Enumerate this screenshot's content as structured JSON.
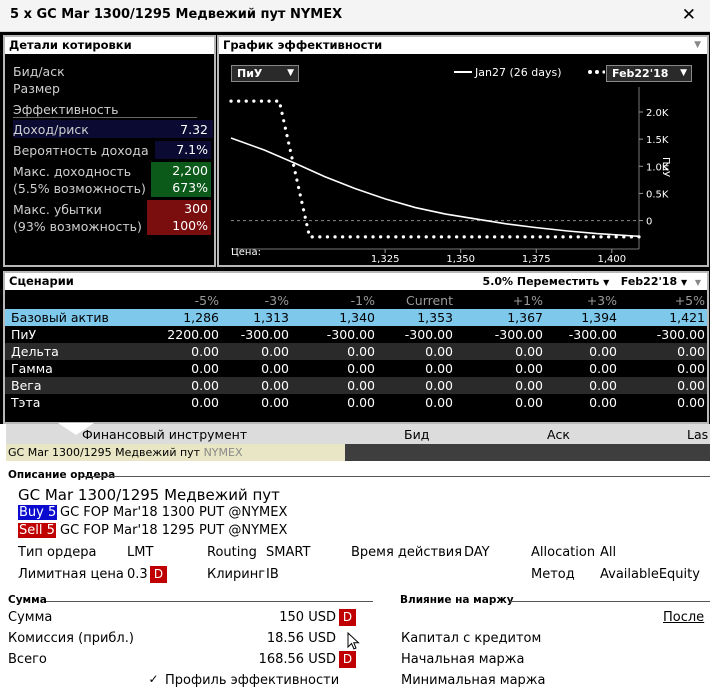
{
  "window": {
    "title": "5 x GC Mar 1300/1295 Медвежий пут NYMEX",
    "close_glyph": "✕"
  },
  "quote_panel": {
    "title": "Детали котировки",
    "bid_ask_label": "Бид/аск",
    "size_label": "Размер",
    "efficiency_label": "Эффективность",
    "return_risk_label": "Доход/риск",
    "return_risk_value": "7.32",
    "prob_label": "Вероятность дохода",
    "prob_value": "7.1%",
    "max_return_label": "Макс. доходность",
    "max_return_value": "2,200",
    "max_return_sub_label": "(5.5% возможность)",
    "max_return_sub_value": "673%",
    "max_loss_label": "Макс. убытки",
    "max_loss_value": "300",
    "max_loss_sub_label": "(93% возможность)",
    "max_loss_sub_value": "100%"
  },
  "chart_panel": {
    "title": "График эффективности",
    "metric_select": "ПиУ",
    "legend_line": "Jan27 (26 days)",
    "legend_dots_select": "Feb22'18",
    "price_label": "Цена:",
    "y_axis_label": "ПиУ"
  },
  "chart_data": {
    "type": "line",
    "title": "",
    "xlabel": "Цена:",
    "ylabel": "ПиУ",
    "x_ticks": [
      "1,325",
      "1,350",
      "1,375",
      "1,400"
    ],
    "y_ticks": [
      "2.0K",
      "1.5K",
      "1.0K",
      "0.5K",
      "0"
    ],
    "xlim": [
      1274,
      1409
    ],
    "ylim": [
      -450,
      2350
    ],
    "series": [
      {
        "name": "Jan27 (26 days)",
        "style": "solid",
        "color": "#ffffff",
        "x": [
          1274,
          1285,
          1295,
          1305,
          1315,
          1325,
          1335,
          1345,
          1355,
          1365,
          1375,
          1385,
          1395,
          1409
        ],
        "y": [
          1520,
          1300,
          1060,
          810,
          590,
          400,
          240,
          120,
          30,
          -60,
          -130,
          -190,
          -240,
          -290
        ]
      },
      {
        "name": "Feb22'18",
        "style": "dotted",
        "color": "#ffffff",
        "x": [
          1274,
          1282,
          1290,
          1295,
          1300,
          1409
        ],
        "y": [
          2200,
          2200,
          2200,
          950,
          -300,
          -300
        ]
      }
    ]
  },
  "scenarios": {
    "title": "Сценарии",
    "move_select": "5.0% Переместить",
    "date_select": "Feb22'18",
    "columns": [
      "-5%",
      "-3%",
      "-1%",
      "Current",
      "+1%",
      "+3%",
      "+5%"
    ],
    "rows": [
      {
        "label": "Базовый актив",
        "values": [
          "1,286",
          "1,313",
          "1,340",
          "1,353",
          "1,367",
          "1,394",
          "1,421"
        ]
      },
      {
        "label": "ПиУ",
        "values": [
          "2200.00",
          "-300.00",
          "-300.00",
          "-300.00",
          "-300.00",
          "-300.00",
          "-300.00"
        ]
      },
      {
        "label": "Дельта",
        "values": [
          "0.00",
          "0.00",
          "0.00",
          "0.00",
          "0.00",
          "0.00",
          "0.00"
        ]
      },
      {
        "label": "Гамма",
        "values": [
          "0.00",
          "0.00",
          "0.00",
          "0.00",
          "0.00",
          "0.00",
          "0.00"
        ]
      },
      {
        "label": "Вега",
        "values": [
          "0.00",
          "0.00",
          "0.00",
          "0.00",
          "0.00",
          "0.00",
          "0.00"
        ]
      },
      {
        "label": "Тэта",
        "values": [
          "0.00",
          "0.00",
          "0.00",
          "0.00",
          "0.00",
          "0.00",
          "0.00"
        ]
      }
    ]
  },
  "instrument_table": {
    "headers": {
      "instrument": "Финансовый инструмент",
      "bid": "Бид",
      "ask": "Аск",
      "last": "Las"
    },
    "row_symbol": "GC Mar 1300/1295 Медвежий пут",
    "row_exchange": "NYMEX"
  },
  "order": {
    "section_title": "Описание ордера",
    "title": "GC Mar 1300/1295 Медвежий пут",
    "leg1_tag": "Buy 5",
    "leg1_desc": "GC FOP Mar'18 1300 PUT @NYMEX",
    "leg2_tag": "Sell 5",
    "leg2_desc": "GC FOP Mar'18 1295 PUT @NYMEX",
    "order_type_label": "Тип ордера",
    "order_type_value": "LMT",
    "routing_label": "Routing",
    "routing_value": "SMART",
    "tif_label": "Время действия",
    "tif_value": "DAY",
    "allocation_label": "Allocation",
    "allocation_value": "All",
    "limit_label": "Лимитная цена",
    "limit_value": "0.3",
    "clearing_label": "Клиринг",
    "clearing_value": "IB",
    "method_label": "Метод",
    "method_value": "AvailableEquity",
    "d_label": "D"
  },
  "amount": {
    "section_title": "Сумма",
    "sum_label": "Сумма",
    "sum_value": "150 USD",
    "commission_label": "Комиссия (прибл.)",
    "commission_value": "18.56 USD",
    "total_label": "Всего",
    "total_value": "168.56 USD",
    "profile_label": "Профиль эффективности",
    "profile_checked_glyph": "✓"
  },
  "margin": {
    "section_title": "Влияние на маржу",
    "after_link": "После",
    "equity_label": "Капитал с кредитом",
    "initial_label": "Начальная маржа",
    "min_label": "Минимальная маржа"
  }
}
